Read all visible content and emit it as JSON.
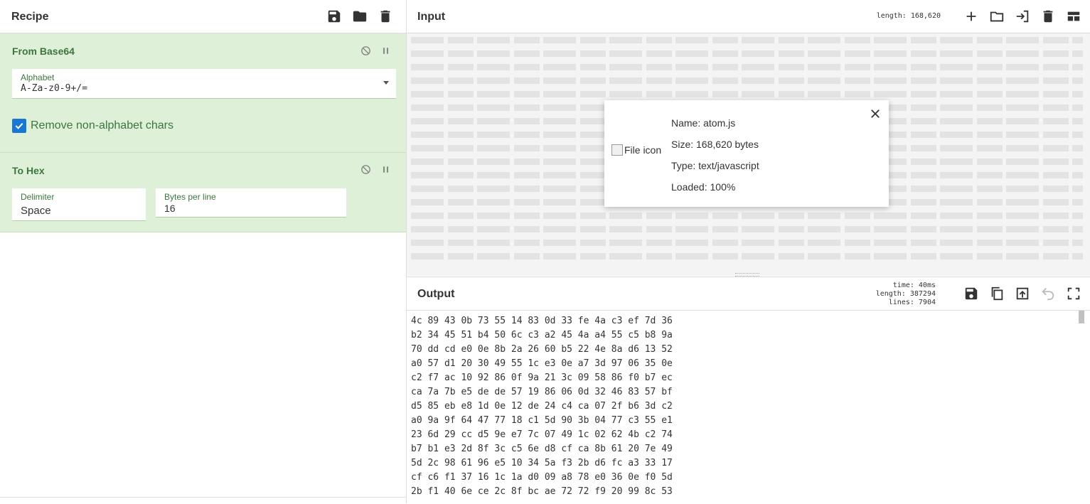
{
  "recipe": {
    "title": "Recipe",
    "operations": [
      {
        "title": "From Base64",
        "alphabet_label": "Alphabet",
        "alphabet_value": "A-Za-z0-9+/=",
        "checkbox_label": "Remove non-alphabet chars",
        "checkbox_checked": true
      },
      {
        "title": "To Hex",
        "delimiter_label": "Delimiter",
        "delimiter_value": "Space",
        "bytes_label": "Bytes per line",
        "bytes_value": "16"
      }
    ]
  },
  "input": {
    "title": "Input",
    "length": "length: 168,620",
    "file": {
      "icon_alt": "File icon",
      "name": "Name: atom.js",
      "size": "Size: 168,620 bytes",
      "type": "Type: text/javascript",
      "loaded": "Loaded: 100%"
    }
  },
  "output": {
    "title": "Output",
    "time": "time:   40ms",
    "length": "length: 387294",
    "lines": "lines:   7904",
    "text": "4c 89 43 0b 73 55 14 83 0d 33 fe 4a c3 ef 7d 36\nb2 34 45 51 b4 50 6c c3 a2 45 4a a4 55 c5 b8 9a\n70 dd cd e0 0e 8b 2a 26 60 b5 22 4e 8a d6 13 52\na0 57 d1 20 30 49 55 1c e3 0e a7 3d 97 06 35 0e\nc2 f7 ac 10 92 86 0f 9a 21 3c 09 58 86 f0 b7 ec\nca 7a 7b e5 de de 57 19 86 06 0d 32 46 83 57 bf\nd5 85 eb e8 1d 0e 12 de 24 c4 ca 07 2f b6 3d c2\na0 9a 9f 64 47 77 18 c1 5d 90 3b 04 77 c3 55 e1\n23 6d 29 cc d5 9e e7 7c 07 49 1c 02 62 4b c2 74\nb7 b1 e3 2d 8f 3c c5 6e d8 cf ca 8b 61 20 7e 49\n5d 2c 98 61 96 e5 10 34 5a f3 2b d6 fc a3 33 17\ncf c6 f1 37 16 1c 1a d0 09 a8 78 e0 36 0e f0 5d\n2b f1 40 6e ce 2c 8f bc ae 72 72 f9 20 99 8c 53"
  },
  "icons": [
    "save-icon",
    "folder-open-icon",
    "trash-icon",
    "disable-icon",
    "pause-icon",
    "plus-icon",
    "import-icon",
    "layout-icon",
    "copy-icon",
    "export-icon",
    "undo-icon",
    "fullscreen-icon",
    "close-icon"
  ]
}
